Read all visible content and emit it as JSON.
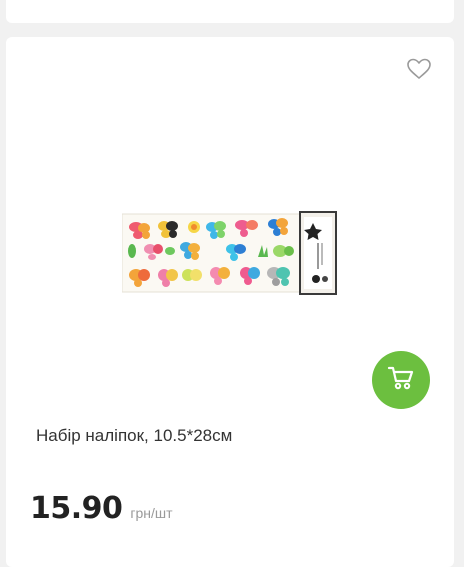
{
  "product": {
    "title": "Набір наліпок, 10.5*28см",
    "price": "15.90",
    "unit": "грн/шт"
  },
  "icons": {
    "favorite": "heart-outline-icon",
    "cart": "shopping-cart-icon"
  },
  "colors": {
    "accent": "#6cbf3f",
    "background": "#f1f1f1",
    "card": "#ffffff"
  }
}
